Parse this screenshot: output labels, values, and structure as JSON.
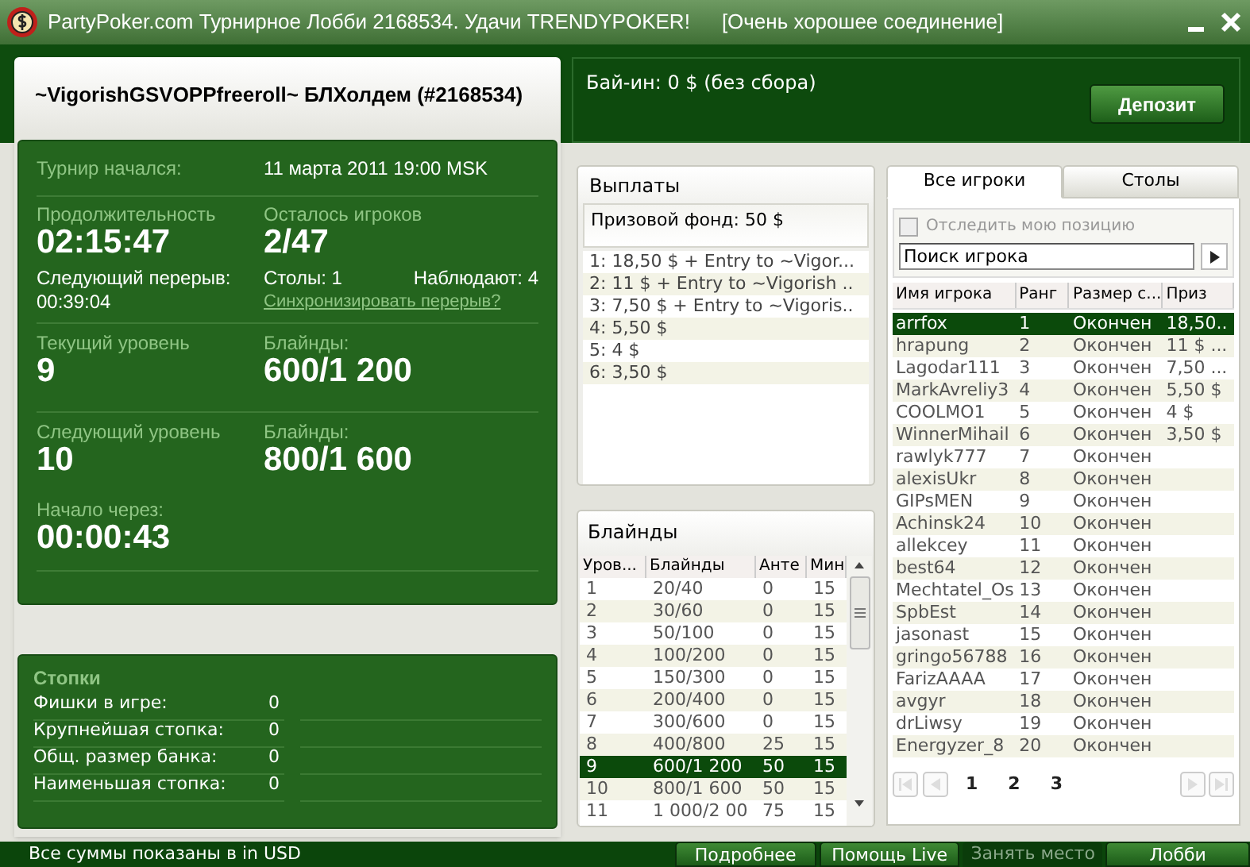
{
  "window": {
    "title": "PartyPoker.com Турнирное Лобби 2168534. Удачи TRENDYPOKER!",
    "connection": "[Очень хорошее соединение]"
  },
  "tournament": {
    "title": "~VigorishGSVOPPfreeroll~ БЛХолдем (#2168534)",
    "started_label": "Турнир начался:",
    "started_value": "11 марта 2011  19:00 MSK",
    "duration_label": "Продолжительность",
    "duration_value": "02:15:47",
    "players_left_label": "Осталось игроков",
    "players_left_value": "2/47",
    "next_break_label": "Следующий перерыв:",
    "next_break_value": "00:39:04",
    "tables": "Столы: 1",
    "observers": "Наблюдают: 4",
    "sync_link": "Синхронизировать перерыв?",
    "current_level_label": "Текущий уровень",
    "current_level_value": "9",
    "current_blinds_label": "Блайнды:",
    "current_blinds_value": "600/1 200",
    "next_level_label": "Следующий уровень",
    "next_level_value": "10",
    "next_blinds_label": "Блайнды:",
    "next_blinds_value": "800/1 600",
    "start_in_label": "Начало через:",
    "start_in_value": "00:00:43"
  },
  "stacks": {
    "title": "Стопки",
    "rows": [
      {
        "label": "Фишки в игре:",
        "value": "0"
      },
      {
        "label": "Крупнейшая стопка:",
        "value": "0"
      },
      {
        "label": "Общ. размер банка:",
        "value": "0"
      },
      {
        "label": "Наименьшая стопка:",
        "value": "0"
      }
    ]
  },
  "buy_in": "Бай-ин: 0 $ (без сбора)",
  "deposit_button": "Депозит",
  "payouts": {
    "title": "Выплаты",
    "prize_pool": "Призовой фонд: 50 $",
    "items": [
      "1: 18,50 $ + Entry to ~Vigor...",
      "2: 11 $ + Entry to ~Vigorish ..",
      "3: 7,50 $ + Entry to ~Vigoris..",
      "4: 5,50 $",
      "5: 4 $",
      "6: 3,50 $"
    ]
  },
  "blinds": {
    "title": "Блайнды",
    "columns": [
      "Уров...",
      "Блайнды",
      "Анте",
      "Мин"
    ],
    "rows": [
      {
        "cells": [
          "1",
          "20/40",
          "0",
          "15"
        ],
        "selected": false
      },
      {
        "cells": [
          "2",
          "30/60",
          "0",
          "15"
        ],
        "selected": false
      },
      {
        "cells": [
          "3",
          "50/100",
          "0",
          "15"
        ],
        "selected": false
      },
      {
        "cells": [
          "4",
          "100/200",
          "0",
          "15"
        ],
        "selected": false
      },
      {
        "cells": [
          "5",
          "150/300",
          "0",
          "15"
        ],
        "selected": false
      },
      {
        "cells": [
          "6",
          "200/400",
          "0",
          "15"
        ],
        "selected": false
      },
      {
        "cells": [
          "7",
          "300/600",
          "0",
          "15"
        ],
        "selected": false
      },
      {
        "cells": [
          "8",
          "400/800",
          "25",
          "15"
        ],
        "selected": false
      },
      {
        "cells": [
          "9",
          "600/1 200",
          "50",
          "15"
        ],
        "selected": true
      },
      {
        "cells": [
          "10",
          "800/1 600",
          "50",
          "15"
        ],
        "selected": false
      },
      {
        "cells": [
          "11",
          "1 000/2 00",
          "75",
          "15"
        ],
        "selected": false
      }
    ]
  },
  "players": {
    "tabs": [
      {
        "label": "Все игроки",
        "selected": true
      },
      {
        "label": "Столы",
        "selected": false
      }
    ],
    "track_position": {
      "label": "Отследить мою позицию",
      "checked": false,
      "disabled": true
    },
    "search": {
      "placeholder": "Поиск игрока"
    },
    "columns": [
      "Имя игрока",
      "Ранг",
      "Размер с...",
      "Приз"
    ],
    "rows": [
      {
        "cells": [
          "arrfox",
          "1",
          "Окончен",
          "18,50.."
        ],
        "selected": true
      },
      {
        "cells": [
          "hrapung",
          "2",
          "Окончен",
          "11 $ ..."
        ],
        "selected": false
      },
      {
        "cells": [
          "Lagodar111",
          "3",
          "Окончен",
          "7,50 ..."
        ],
        "selected": false
      },
      {
        "cells": [
          "MarkAvreliy3",
          "4",
          "Окончен",
          "5,50 $"
        ],
        "selected": false
      },
      {
        "cells": [
          "COOLMO1",
          "5",
          "Окончен",
          "4 $"
        ],
        "selected": false
      },
      {
        "cells": [
          "WinnerMihail",
          "6",
          "Окончен",
          "3,50 $"
        ],
        "selected": false
      },
      {
        "cells": [
          "rawlyk777",
          "7",
          "Окончен",
          ""
        ],
        "selected": false
      },
      {
        "cells": [
          "alexisUkr",
          "8",
          "Окончен",
          ""
        ],
        "selected": false
      },
      {
        "cells": [
          "GIPsMEN",
          "9",
          "Окончен",
          ""
        ],
        "selected": false
      },
      {
        "cells": [
          "Achinsk24",
          "10",
          "Окончен",
          ""
        ],
        "selected": false
      },
      {
        "cells": [
          "allekcey",
          "11",
          "Окончен",
          ""
        ],
        "selected": false
      },
      {
        "cells": [
          "best64",
          "12",
          "Окончен",
          ""
        ],
        "selected": false
      },
      {
        "cells": [
          "Mechtatel_Os",
          "13",
          "Окончен",
          ""
        ],
        "selected": false
      },
      {
        "cells": [
          "SpbEst",
          "14",
          "Окончен",
          ""
        ],
        "selected": false
      },
      {
        "cells": [
          "jasonast",
          "15",
          "Окончен",
          ""
        ],
        "selected": false
      },
      {
        "cells": [
          "gringo56788",
          "16",
          "Окончен",
          ""
        ],
        "selected": false
      },
      {
        "cells": [
          "FarizAAAA",
          "17",
          "Окончен",
          ""
        ],
        "selected": false
      },
      {
        "cells": [
          "avgyr",
          "18",
          "Окончен",
          ""
        ],
        "selected": false
      },
      {
        "cells": [
          "drLiwsy",
          "19",
          "Окончен",
          ""
        ],
        "selected": false
      },
      {
        "cells": [
          "Energyzer_8",
          "20",
          "Окончен",
          ""
        ],
        "selected": false
      }
    ],
    "pages": [
      "1",
      "2",
      "3"
    ]
  },
  "footer": {
    "note": "Все суммы показаны в in USD",
    "buttons": [
      {
        "label": "Подробнее",
        "disabled": false
      },
      {
        "label": "Помощь Live",
        "disabled": false
      },
      {
        "label": "Занять место",
        "disabled": true
      },
      {
        "label": "Лобби",
        "disabled": false
      }
    ]
  }
}
